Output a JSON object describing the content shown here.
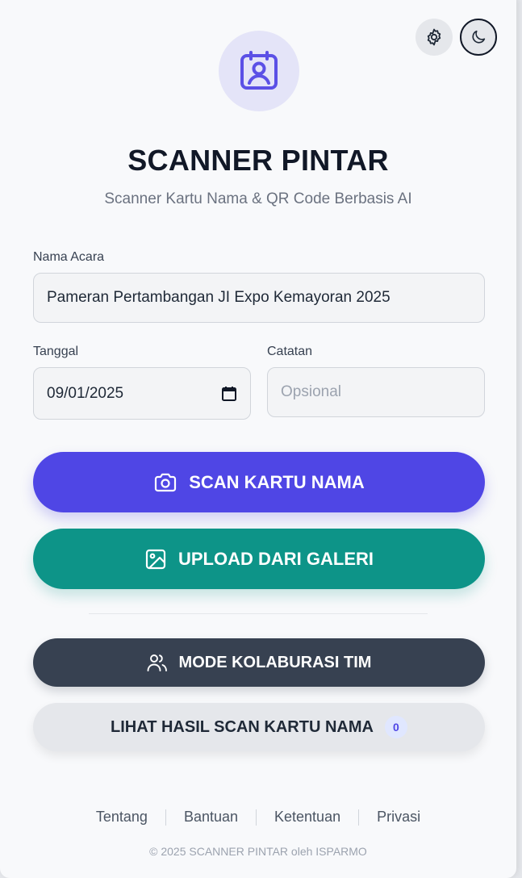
{
  "header": {
    "settings_icon": "settings-gear-icon",
    "theme_icon": "moon-icon",
    "logo_icon": "contact-badge-icon"
  },
  "app": {
    "title": "SCANNER PINTAR",
    "subtitle": "Scanner Kartu Nama & QR Code Berbasis AI"
  },
  "form": {
    "event_label": "Nama Acara",
    "event_value": "Pameran Pertambangan JI Expo Kemayoran 2025",
    "date_label": "Tanggal",
    "date_value": "09/01/2025",
    "notes_label": "Catatan",
    "notes_placeholder": "Opsional"
  },
  "actions": {
    "scan_label": "SCAN KARTU NAMA",
    "upload_label": "UPLOAD DARI GALERI",
    "team_label": "MODE KOLABURASI TIM",
    "results_label": "LIHAT HASIL SCAN KARTU NAMA",
    "results_count": "0"
  },
  "footer": {
    "links": [
      "Tentang",
      "Bantuan",
      "Ketentuan",
      "Privasi"
    ],
    "copyright": "© 2025 SCANNER PINTAR oleh ISPARMO"
  },
  "colors": {
    "primary": "#4f46e5",
    "teal": "#0d9488",
    "dark": "#374151",
    "light": "#e5e7eb"
  }
}
